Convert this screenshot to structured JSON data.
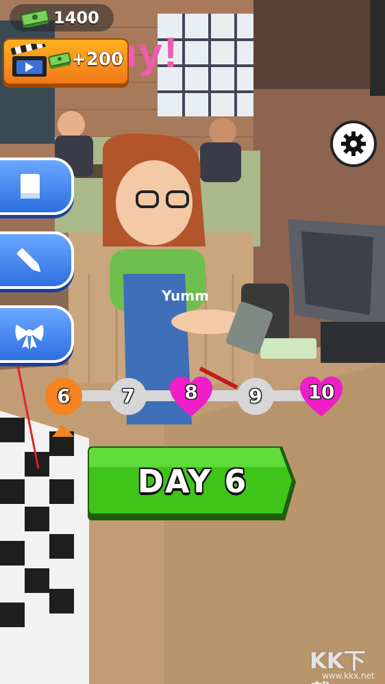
{
  "hud": {
    "money": "1400",
    "ad_reward": "+200",
    "money_icon": "cash-stack-icon",
    "ad_icon": "clapperboard-icon"
  },
  "sign": {
    "text": "mmy!"
  },
  "apron_text": "Yumm",
  "settings": {
    "icon": "gear-icon"
  },
  "side_menu": [
    {
      "name": "book",
      "icon": "book-icon"
    },
    {
      "name": "edit",
      "icon": "pencil-icon"
    },
    {
      "name": "gift",
      "icon": "ribbon-bow-icon"
    }
  ],
  "progress": {
    "days": [
      {
        "label": "6",
        "state": "current"
      },
      {
        "label": "7",
        "state": "normal"
      },
      {
        "label": "8",
        "state": "heart"
      },
      {
        "label": "9",
        "state": "normal"
      },
      {
        "label": "10",
        "state": "heart"
      }
    ]
  },
  "day_button": {
    "label": "DAY 6"
  },
  "watermark": {
    "text": "KK下载",
    "url": "www.kkx.net"
  },
  "colors": {
    "accent_orange": "#f5831f",
    "button_green": "#3fc51a",
    "side_blue": "#2d6fe0",
    "heart_magenta": "#ee1ec8",
    "sign_pink": "#f05bb0"
  }
}
